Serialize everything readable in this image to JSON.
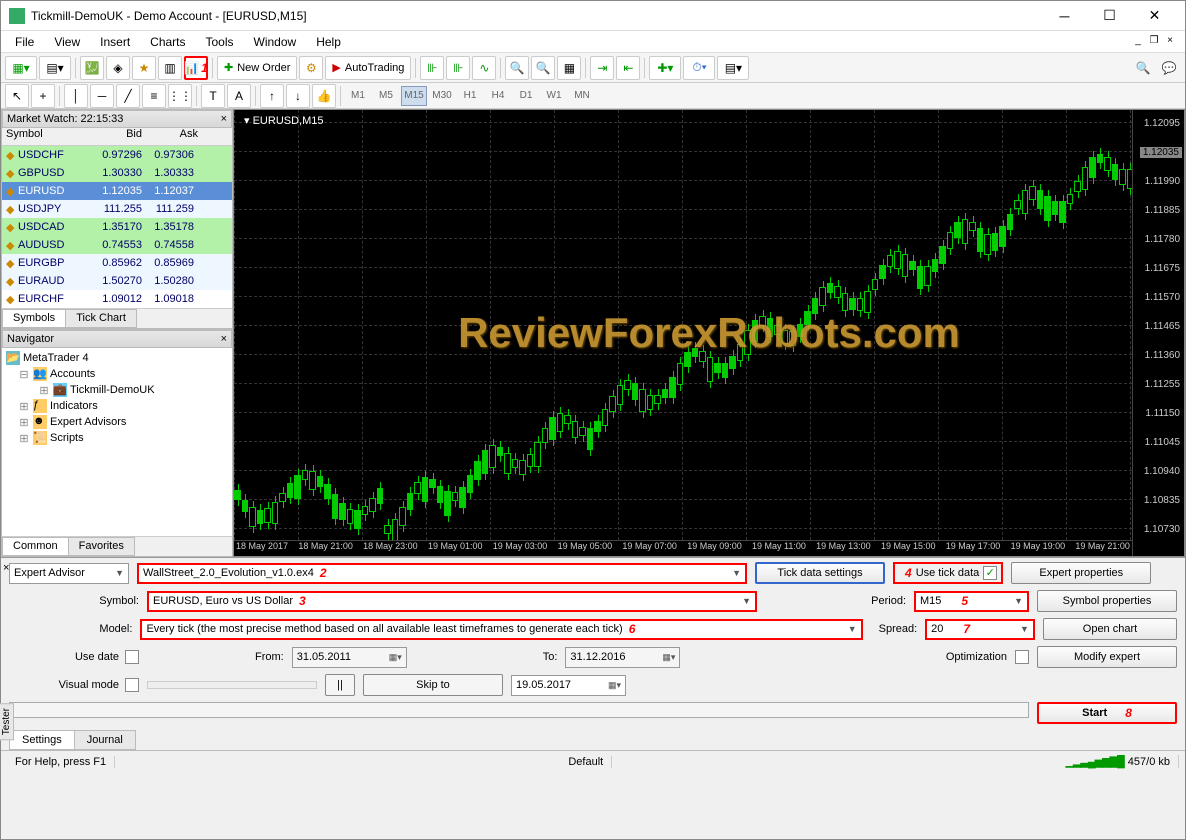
{
  "title": "Tickmill-DemoUK - Demo Account - [EURUSD,M15]",
  "menu": [
    "File",
    "View",
    "Insert",
    "Charts",
    "Tools",
    "Window",
    "Help"
  ],
  "toolbar": {
    "new_order": "New Order",
    "autotrading": "AutoTrading",
    "ann1": "1"
  },
  "timeframes": [
    "M1",
    "M5",
    "M15",
    "M30",
    "H1",
    "H4",
    "D1",
    "W1",
    "MN"
  ],
  "active_tf": "M15",
  "market_watch": {
    "title": "Market Watch: 22:15:33",
    "cols": [
      "Symbol",
      "Bid",
      "Ask"
    ],
    "rows": [
      {
        "sym": "USDCHF",
        "bid": "0.97296",
        "ask": "0.97306",
        "cls": "row-green"
      },
      {
        "sym": "GBPUSD",
        "bid": "1.30330",
        "ask": "1.30333",
        "cls": "row-green"
      },
      {
        "sym": "EURUSD",
        "bid": "1.12035",
        "ask": "1.12037",
        "cls": "row-blue"
      },
      {
        "sym": "USDJPY",
        "bid": "111.255",
        "ask": "111.259",
        "cls": "row-white2"
      },
      {
        "sym": "USDCAD",
        "bid": "1.35170",
        "ask": "1.35178",
        "cls": "row-green"
      },
      {
        "sym": "AUDUSD",
        "bid": "0.74553",
        "ask": "0.74558",
        "cls": "row-green"
      },
      {
        "sym": "EURGBP",
        "bid": "0.85962",
        "ask": "0.85969",
        "cls": "row-white2"
      },
      {
        "sym": "EURAUD",
        "bid": "1.50270",
        "ask": "1.50280",
        "cls": "row-white2"
      },
      {
        "sym": "EURCHF",
        "bid": "1.09012",
        "ask": "1.09018",
        "cls": "row-white"
      }
    ],
    "tabs": [
      "Symbols",
      "Tick Chart"
    ]
  },
  "navigator": {
    "title": "Navigator",
    "root": "MetaTrader 4",
    "items": [
      "Accounts",
      "Tickmill-DemoUK",
      "Indicators",
      "Expert Advisors",
      "Scripts"
    ],
    "tabs": [
      "Common",
      "Favorites"
    ]
  },
  "chart": {
    "title": "EURUSD,M15",
    "watermark": "ReviewForexRobots.com",
    "yticks": [
      "1.12095",
      "1.12035",
      "1.11990",
      "1.11885",
      "1.11780",
      "1.11675",
      "1.11570",
      "1.11465",
      "1.11360",
      "1.11255",
      "1.11150",
      "1.11045",
      "1.10940",
      "1.10835",
      "1.10730"
    ],
    "xticks": [
      "18 May 2017",
      "18 May 21:00",
      "18 May 23:00",
      "19 May 01:00",
      "19 May 03:00",
      "19 May 05:00",
      "19 May 07:00",
      "19 May 09:00",
      "19 May 11:00",
      "19 May 13:00",
      "19 May 15:00",
      "19 May 17:00",
      "19 May 19:00",
      "19 May 21:00"
    ]
  },
  "tester": {
    "ea_label": "Expert Advisor",
    "ea_value": "WallStreet_2.0_Evolution_v1.0.ex4",
    "ann2": "2",
    "tick_settings": "Tick data settings",
    "use_tick": "Use tick data",
    "ann4": "4",
    "ep": "Expert properties",
    "symbol_label": "Symbol:",
    "symbol_value": "EURUSD, Euro vs US Dollar",
    "ann3": "3",
    "period_label": "Period:",
    "period_value": "M15",
    "ann5": "5",
    "sp": "Symbol properties",
    "model_label": "Model:",
    "model_value": "Every tick (the most precise method based on all available least timeframes to generate each tick)",
    "ann6": "6",
    "spread_label": "Spread:",
    "spread_value": "20",
    "ann7": "7",
    "oc": "Open chart",
    "use_date": "Use date",
    "from_label": "From:",
    "from_value": "31.05.2011",
    "to_label": "To:",
    "to_value": "31.12.2016",
    "opt": "Optimization",
    "me": "Modify expert",
    "visual": "Visual mode",
    "skip": "Skip to",
    "skip_date": "19.05.2017",
    "start": "Start",
    "ann8": "8",
    "tabs": [
      "Settings",
      "Journal"
    ],
    "panel": "Tester"
  },
  "statusbar": {
    "help": "For Help, press F1",
    "profile": "Default",
    "kb": "457/0 kb"
  }
}
